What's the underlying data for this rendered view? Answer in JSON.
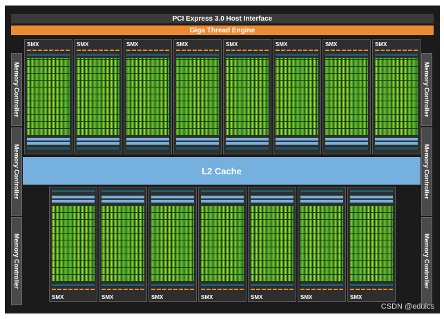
{
  "header": {
    "pcie_label": "PCI Express 3.0 Host Interface",
    "giga_label": "Giga Thread Engine"
  },
  "cache": {
    "l2_label": "L2 Cache"
  },
  "memory_controllers": {
    "label": "Memory Controller",
    "left": [
      "Memory Controller",
      "Memory Controller",
      "Memory Controller"
    ],
    "right": [
      "Memory Controller",
      "Memory Controller",
      "Memory Controller"
    ]
  },
  "smx_top": [
    "SMX",
    "SMX",
    "SMX",
    "SMX",
    "SMX",
    "SMX",
    "SMX",
    "SMX"
  ],
  "smx_bottom": [
    "SMX",
    "SMX",
    "SMX",
    "SMX",
    "SMX",
    "SMX",
    "SMX"
  ],
  "colors": {
    "background": "#1b1b1b",
    "giga_engine": "#ec8a32",
    "l2_cache": "#75b0de",
    "core_green": "#3fa32a",
    "core_yellow": "#d6c21e"
  },
  "watermark": "CSDN @eduics"
}
